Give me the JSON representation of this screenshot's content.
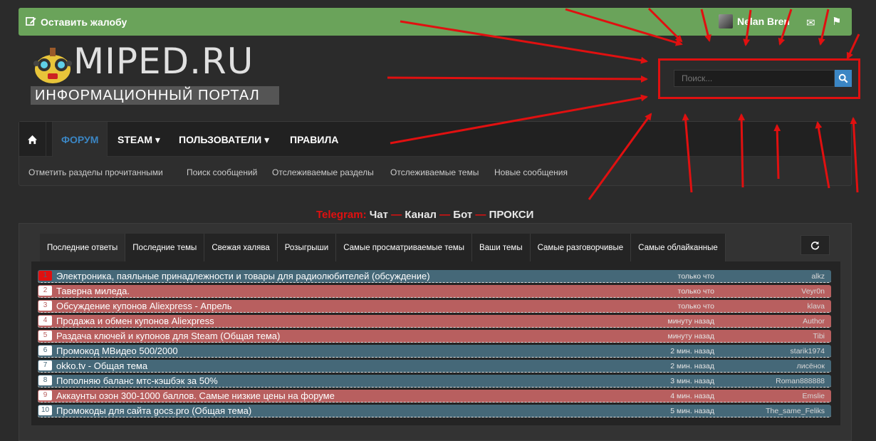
{
  "topbar": {
    "complaint_label": "Оставить жалобу",
    "username": "Nelan Bren"
  },
  "logo": {
    "title": "MIPED.RU",
    "subtitle": "ИНФОРМАЦИОННЫЙ ПОРТАЛ"
  },
  "search": {
    "placeholder": "Поиск..."
  },
  "nav": {
    "items": [
      "ФОРУМ",
      "STEAM ▾",
      "ПОЛЬЗОВАТЕЛИ ▾",
      "ПРАВИЛА"
    ],
    "sub": [
      "Отметить разделы прочитанными",
      "Поиск сообщений",
      "Отслеживаемые разделы",
      "Отслеживаемые темы",
      "Новые сообщения"
    ]
  },
  "telegram": {
    "label": "Telegram:",
    "links": [
      "Чат",
      "Канал",
      "Бот",
      "ПРОКСИ"
    ],
    "sep": "—"
  },
  "tabs": [
    "Последние ответы",
    "Последние темы",
    "Свежая халява",
    "Розыгрыши",
    "Самые просматриваемые темы",
    "Ваши темы",
    "Самые разговорчивые",
    "Самые облайканные"
  ],
  "threads": [
    {
      "num": "1",
      "title": "Электроника, паяльные принадлежности и товары для радиолюбителей (обсуждение)",
      "time": "только что",
      "author": "alkz",
      "color": "blue"
    },
    {
      "num": "2",
      "title": "Таверна миледа.",
      "time": "только что",
      "author": "Veyr0n",
      "color": "red"
    },
    {
      "num": "3",
      "title": "Обсуждение купонов Aliexpress - Апрель",
      "time": "только что",
      "author": "klava",
      "color": "red"
    },
    {
      "num": "4",
      "title": "Продажа и обмен купонов Aliexpress",
      "time": "минуту назад",
      "author": "Author",
      "color": "red"
    },
    {
      "num": "5",
      "title": "Раздача ключей и купонов для Steam (Общая тема)",
      "time": "минуту назад",
      "author": "Tibi",
      "color": "red"
    },
    {
      "num": "6",
      "title": "Промокод МВидео 500/2000",
      "time": "2 мин. назад",
      "author": "starik1974",
      "color": "blue"
    },
    {
      "num": "7",
      "title": "okko.tv - Общая тема",
      "time": "2 мин. назад",
      "author": "лисёнок",
      "color": "blue"
    },
    {
      "num": "8",
      "title": "Пополняю баланс мтс-кэшбэк за 50%",
      "time": "3 мин. назад",
      "author": "Roman888888",
      "color": "blue"
    },
    {
      "num": "9",
      "title": "Аккаунты озон 300-1000 баллов. Самые низкие цены на форуме",
      "time": "4 мин. назад",
      "author": "Emslie",
      "color": "red"
    },
    {
      "num": "10",
      "title": "Промокоды для сайта gocs.pro (Общая тема)",
      "time": "5 мин. назад",
      "author": "The_same_Feliks",
      "color": "blue"
    }
  ]
}
